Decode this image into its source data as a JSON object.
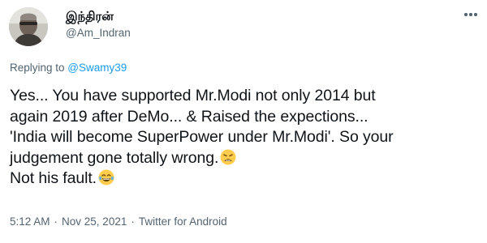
{
  "author": {
    "display_name": "இந்திரன்",
    "handle": "@Am_Indran",
    "avatar_icon": "avatar-photo"
  },
  "reply": {
    "prefix": "Replying to ",
    "mention": "@Swamy39"
  },
  "tweet": {
    "lines": [
      "Yes... You have supported Mr.Modi not only 2014 but",
      "again 2019 after DeMo... & Raised the expections...",
      "'India will become SuperPower under Mr.Modi'. So your",
      "judgement gone totally wrong.",
      "Not his fault."
    ],
    "emojis": [
      "weary-face-emoji",
      "crying-laughing-emoji"
    ]
  },
  "meta": {
    "time": "5:12 AM",
    "separator": "·",
    "date": "Nov 25, 2021",
    "source": "Twitter for Android"
  },
  "colors": {
    "text": "#0f1419",
    "secondary": "#536471",
    "link": "#1d9bf0"
  }
}
